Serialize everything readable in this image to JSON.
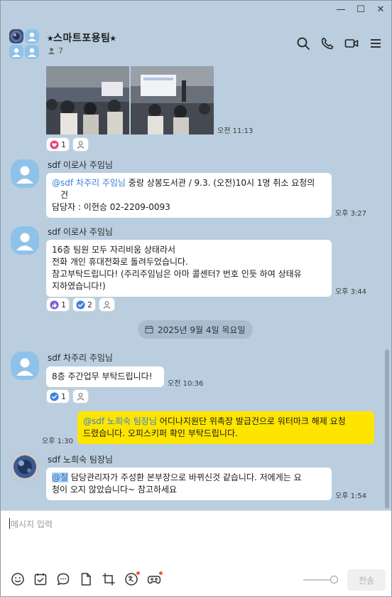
{
  "window": {
    "minimize": "—",
    "maximize": "☐",
    "close": "✕"
  },
  "header": {
    "title": "⭑스마트포용팀⭑",
    "member_count": "7"
  },
  "messages": {
    "photo_time": "오전 11:13",
    "photo_reactions": [
      {
        "count": "1"
      }
    ],
    "msg1": {
      "sender": "sdf 이로사 주임님",
      "mention": "@sdf 차주리 주임님",
      "line1": " 중랑 상봉도서관 / 9.3. (오전)10시 1명 취소 요청의",
      "line2": "건",
      "line3": "담당자 : 이현승 02-2209-0093",
      "time": "오후 3:27"
    },
    "msg2": {
      "sender": "sdf 이로사 주임님",
      "line1": "16층 팀원 모두 자리비움 상태라서",
      "line2": "전화 개인 휴대전화로 돌려두었습니다.",
      "line3": "참고부탁드립니다! (주리주임님은 아마 콜센터? 번호 인듯 하여 상태유",
      "line4": "지하였습니다!)",
      "time": "오후 3:44",
      "reactions": [
        {
          "count": "1"
        },
        {
          "count": "2"
        }
      ]
    },
    "date_divider": "2025년 9월 4일 목요일",
    "msg3": {
      "sender": "sdf 차주리 주임님",
      "text": "8층 주간업무 부탁드립니다!",
      "time": "오전 10:36",
      "reactions": [
        {
          "count": "1"
        }
      ]
    },
    "msg4": {
      "mention": "@sdf 노희숙 팀장님",
      "line1": " 어디나지원단 위촉장 발급건으로 워터마크 해제 요청",
      "line2": "드렸습니다. 오피스키퍼 확인 부탁드립니다.",
      "time": "오후 1:30"
    },
    "msg5": {
      "sender": "sdf 노희숙 팀장님",
      "mention": "@철",
      "line1": " 담당관리자가 주성환 본부장으로 바뀌신것 같습니다. 저에게는 요",
      "line2": "청이 오지 않았습니다~ 참고하세요",
      "time": "오후 1:54"
    }
  },
  "input": {
    "placeholder": "메시지 입력",
    "send_label": "전송"
  },
  "colors": {
    "chat_bg": "#bacee0",
    "my_bubble": "#fee500",
    "mention": "#3b7ed8",
    "heart": "#e8457a",
    "check": "#3b82e0",
    "thumb": "#7a5ad8"
  }
}
